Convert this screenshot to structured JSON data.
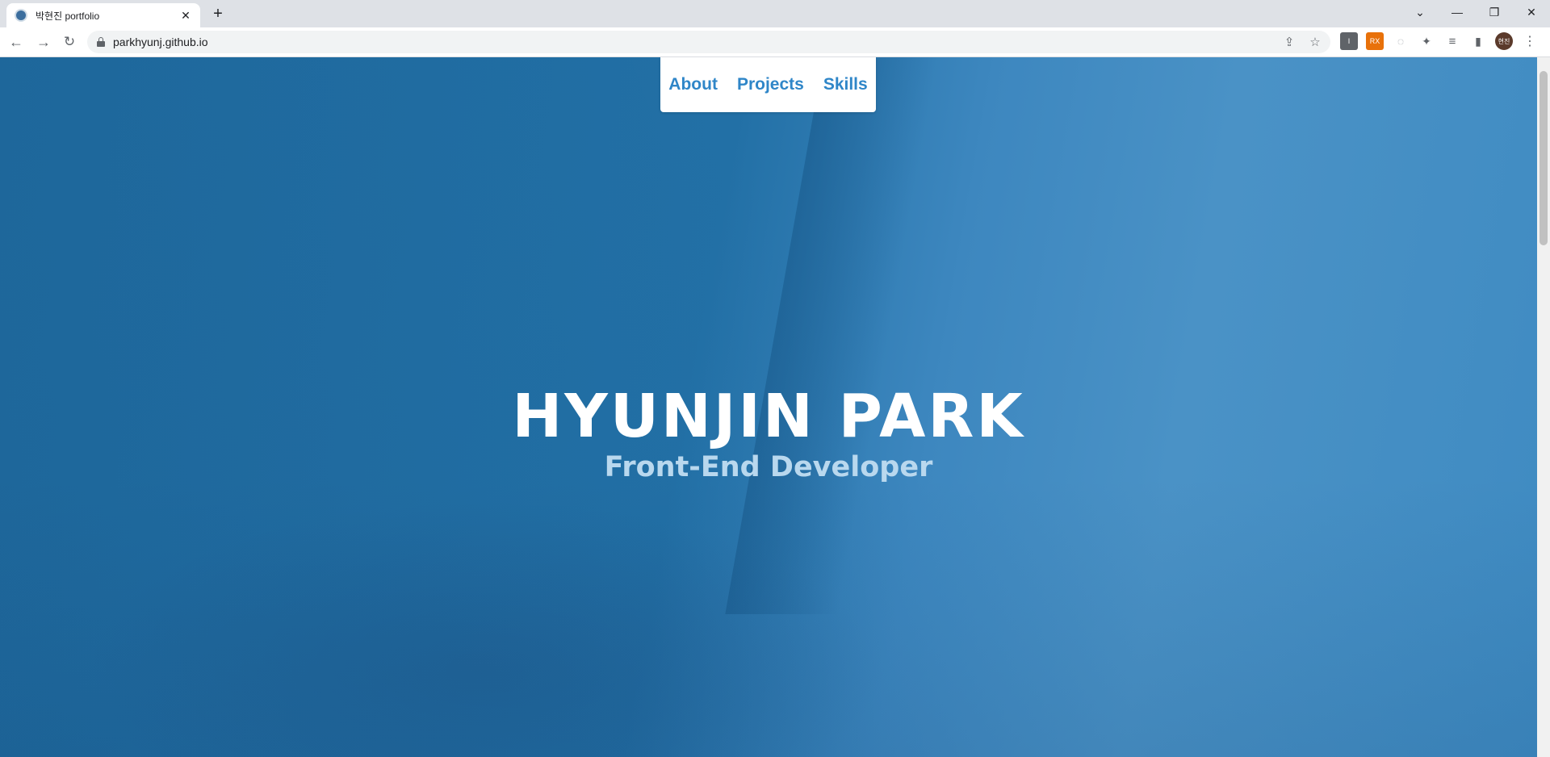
{
  "browser": {
    "tab": {
      "title": "박현진 portfolio",
      "close_glyph": "✕"
    },
    "new_tab_glyph": "+",
    "window_controls": {
      "tablist_glyph": "⌄",
      "minimize_glyph": "—",
      "restore_glyph": "❐",
      "close_glyph": "✕"
    },
    "nav": {
      "back_glyph": "←",
      "forward_glyph": "→",
      "reload_glyph": "↻"
    },
    "url": "parkhyunj.github.io",
    "omnibox_actions": {
      "share_glyph": "⇪",
      "bookmark_glyph": "☆"
    },
    "extensions": {
      "ext1_label": "I",
      "ext2_label": "RX",
      "ext3_glyph": "◌",
      "puzzle_glyph": "✦",
      "media_glyph": "≡",
      "sidepanel_glyph": "▮",
      "profile_label": "현진",
      "menu_glyph": "⋮"
    }
  },
  "page": {
    "nav": {
      "about": "About",
      "projects": "Projects",
      "skills": "Skills"
    },
    "hero": {
      "title": "HYUNJIN PARK",
      "subtitle": "Front-End Developer"
    }
  }
}
